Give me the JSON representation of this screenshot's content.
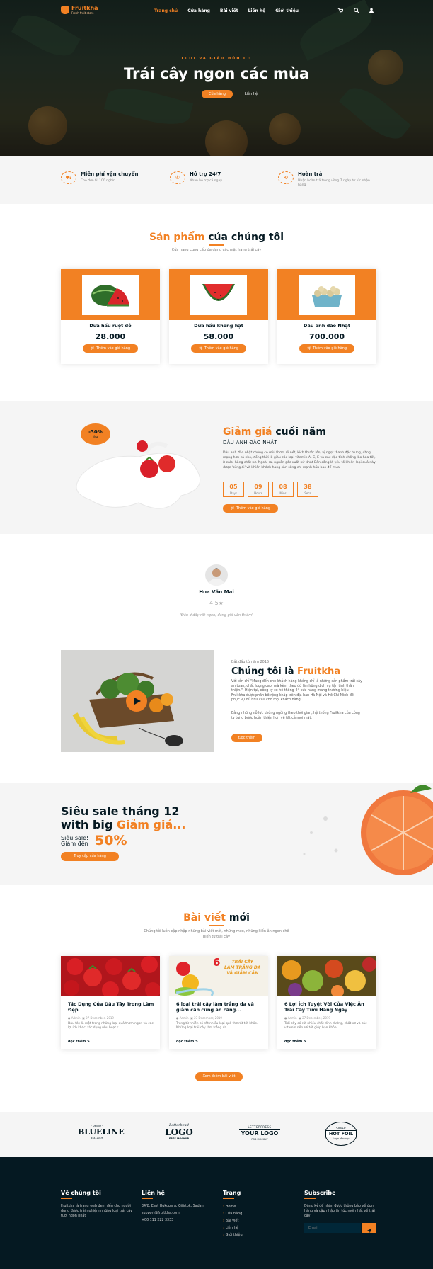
{
  "brand": {
    "name": "Fruitkha",
    "tagline": "Fresh fruit store"
  },
  "nav": {
    "items": [
      "Trang chủ",
      "Cửa hàng",
      "Bài viết",
      "Liên hệ",
      "Giới thiệu"
    ],
    "cart_icon": "cart-icon",
    "search_icon": "search-icon",
    "user_icon": "user-icon"
  },
  "hero": {
    "subtitle": "TƯƠI VÀ GIÀU HỮU CƠ",
    "title": "Trái cây ngon các mùa",
    "btn_shop": "Cửa hàng",
    "btn_contact": "Liên hệ"
  },
  "features": [
    {
      "title": "Miễn phí vận chuyển",
      "text": "Cho đơn từ 100 nghìn",
      "icon": "truck-icon"
    },
    {
      "title": "Hỗ trợ 24/7",
      "text": "Nhận hỗ trợ cả ngày",
      "icon": "phone-icon"
    },
    {
      "title": "Hoàn trả",
      "text": "Nhận hoàn trả trong vòng 7 ngày từ lúc nhận hàng",
      "icon": "refresh-icon"
    }
  ],
  "products_section": {
    "title_accent": "Sản phẩm",
    "title_rest": " của chúng tôi",
    "subtitle": "Cửa hàng cung cấp đa dạng các mặt hàng trái cây"
  },
  "products": [
    {
      "name": "Dưa hấu ruột đỏ",
      "price": "28.000",
      "button": "Thêm vào giỏ hàng"
    },
    {
      "name": "Dưa hấu không hạt",
      "price": "58.000",
      "button": "Thêm vào giỏ hàng"
    },
    {
      "name": "Dâu anh đào Nhật",
      "price": "700.000",
      "button": "Thêm vào giỏ hàng"
    }
  ],
  "deal": {
    "badge_pct": "-30%",
    "badge_unit": "/kg",
    "title_accent": "Giảm giá",
    "title_rest": " cuối năm",
    "product": "DÂU ANH ĐÀO NHẬT",
    "description": "Dâu anh đào nhật chúng có mùi thơm rõ nét, kích thước lớn, vị ngọt thanh đặc trưng, căng mọng hơn cả nho, đồng thời là giàu các loại vitamin A, C, E và các đặc tính chống lão hóa tốt, ít calo, hàng chất xơ. Ngoài ra, nguồn gốc xuất xứ Nhật Bản công là yếu tố khiến loại quả này được 'sùng ái' và khiến khách hàng săn sàng chi mạnh hầu bao để mua.",
    "countdown": [
      {
        "value": "05",
        "label": "Days"
      },
      {
        "value": "09",
        "label": "Hours"
      },
      {
        "value": "08",
        "label": "Mins"
      },
      {
        "value": "38",
        "label": "Secs"
      }
    ],
    "button": "Thêm vào giỏ hàng"
  },
  "testimonial": {
    "name": "Hoa Văn Mai",
    "rating": "4.5",
    "quote": "\"Đâu ở đây rất ngon, đáng giá vẫn thiêm\""
  },
  "about": {
    "since": "Bắt đầu từ năm 2015",
    "title_rest": "Chúng tôi là ",
    "title_accent": "Fruitkha",
    "p1": "Với tôn chỉ \"Mang đến cho khách hàng không chỉ là những sản phẩm trái cây an toàn, chất lượng cao, mà kèm theo đó là những dịch vụ tận tình thân thiện.\". Hiện tại, công ty có hệ thống 44 cửa hàng mang thương hiệu Fruitkha được phân bố rộng khắp trên địa bàn Hà Nội và Hồ Chí Minh để phục vụ đủ nhu cầu cho mọi khách hàng.",
    "p2": "Bằng những nỗ lực không ngừng theo thời gian, hệ thống Fruitkha của công ty từng bước hoàn thiện hơn về tất cả mọi mặt.",
    "button": "Đọc thêm"
  },
  "sale": {
    "line1": "Siêu sale tháng 12",
    "line2_rest": "with big ",
    "line2_accent": "Giảm giá...",
    "small1": "Siêu sale!",
    "small2": "Giảm đến",
    "percent": "50%",
    "button": "Truy cập cửa hàng"
  },
  "blog": {
    "title_accent": "Bài viết",
    "title_rest": " mới",
    "subtitle": "Chúng tôi luôn cập nhập những bài viết mới, những mẹo, những kiến ân ngon chế biến từ trái cây",
    "posts": [
      {
        "title": "Tác Dụng Của Dâu Tây Trong Làm Đẹp",
        "author": "Admin",
        "date": "27 December, 2019",
        "excerpt": "Dâu tây là một trong những loại quả thơm ngon và các lợi ích khác, tác dụng như hoạt r...",
        "more": "đọc thêm >"
      },
      {
        "title": "6 loại trái cây làm trắng da và giảm cân cùng ăn càng...",
        "author": "Admin",
        "date": "27 December, 2019",
        "excerpt": "Trong từ nhiên có rất nhiều loại quả thơ rất tốt khỏe. Những loại trái cây làm trắng da...",
        "more": "đọc thêm >"
      },
      {
        "title": "6 Lợi Ích Tuyệt Vời Của Việc Ăn Trái Cây Tươi Hàng Ngày",
        "author": "Admin",
        "date": "27 December, 2019",
        "excerpt": "Trái cây có rất nhiều chất dinh dưỡng, chất xơ và các vitamin nên rơi tốt giúp bạn khỏe...",
        "more": "đọc thêm >"
      }
    ],
    "post2_overlay_num": "6",
    "post2_overlay": [
      "TRÁI CÂY",
      "LÀM TRẮNG DA",
      "VÀ GIẢM CÂN"
    ],
    "button": "Xem thêm bài viết"
  },
  "partner_logos": [
    {
      "top": "• Deluxe •",
      "main": "BLUELINE",
      "bottom": "Est. 2019"
    },
    {
      "top": "Letterhead",
      "main": "LOGO",
      "bottom": "FREE MOCKUP"
    },
    {
      "top": "LETTERPRESS",
      "main": "YOUR LOGO",
      "bottom": "PSD MOCKUP"
    },
    {
      "top": "SILVER",
      "main": "HOT FOIL",
      "bottom": "Logo Mockup"
    }
  ],
  "footer": {
    "about_title": "Về chúng tôi",
    "about_text": "Fruitkha là trang web đem đến cho người dùng được trải nghiệm những loại trái cây tươi ngon nhất",
    "contact_title": "Liên hệ",
    "address": "34/8, East Hukupara, Gifirtok, Sadan.",
    "email": "support@fruitkha.com",
    "phone": "+00 111 222 3333",
    "pages_title": "Trang",
    "pages": [
      "Home",
      "Cửa hàng",
      "Bài viết",
      "Liên hệ",
      "Giới thiệu"
    ],
    "subscribe_title": "Subscribe",
    "subscribe_text": "Đăng ký để nhận được thông báo về đơn hàng và cập nhập tin tức mới nhất về trái cây",
    "email_placeholder": "Email"
  },
  "colors": {
    "accent": "#F28123",
    "dark": "#051922",
    "light_bg": "#f5f5f5"
  }
}
